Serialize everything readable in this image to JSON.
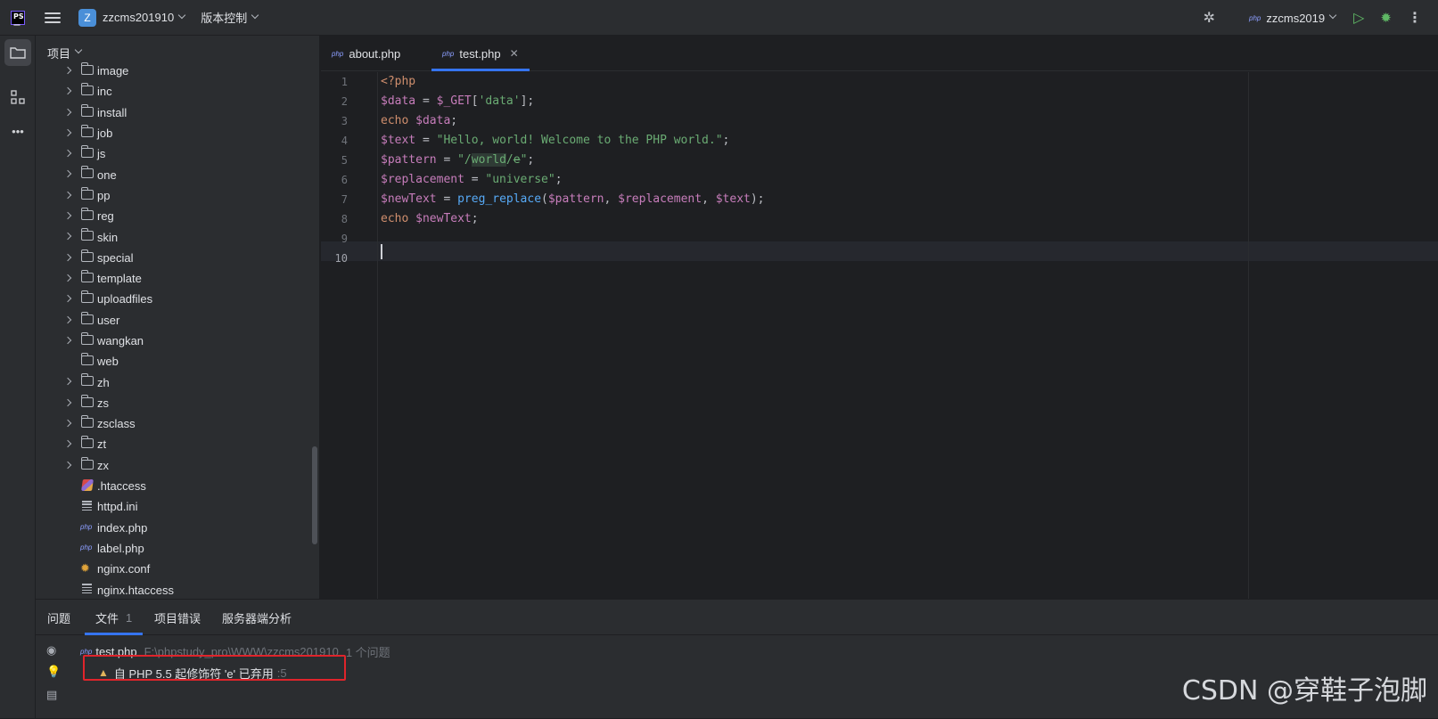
{
  "titlebar": {
    "project_badge": "Z",
    "project_name": "zzcms201910",
    "vcs_label": "版本控制",
    "run_config": "zzcms2019",
    "run_config_icon": "php-icon"
  },
  "project_panel": {
    "header": "项目",
    "items": [
      {
        "name": "image",
        "type": "folder",
        "expandable": true
      },
      {
        "name": "inc",
        "type": "folder",
        "expandable": true
      },
      {
        "name": "install",
        "type": "folder",
        "expandable": true
      },
      {
        "name": "job",
        "type": "folder",
        "expandable": true
      },
      {
        "name": "js",
        "type": "folder",
        "expandable": true
      },
      {
        "name": "one",
        "type": "folder",
        "expandable": true
      },
      {
        "name": "pp",
        "type": "folder",
        "expandable": true
      },
      {
        "name": "reg",
        "type": "folder",
        "expandable": true
      },
      {
        "name": "skin",
        "type": "folder",
        "expandable": true
      },
      {
        "name": "special",
        "type": "folder",
        "expandable": true
      },
      {
        "name": "template",
        "type": "folder",
        "expandable": true
      },
      {
        "name": "uploadfiles",
        "type": "folder",
        "expandable": true
      },
      {
        "name": "user",
        "type": "folder",
        "expandable": true
      },
      {
        "name": "wangkan",
        "type": "folder",
        "expandable": true
      },
      {
        "name": "web",
        "type": "folder",
        "expandable": false
      },
      {
        "name": "zh",
        "type": "folder",
        "expandable": true
      },
      {
        "name": "zs",
        "type": "folder",
        "expandable": true
      },
      {
        "name": "zsclass",
        "type": "folder",
        "expandable": true
      },
      {
        "name": "zt",
        "type": "folder",
        "expandable": true
      },
      {
        "name": "zx",
        "type": "folder",
        "expandable": true
      },
      {
        "name": ".htaccess",
        "type": "htaccess",
        "expandable": false
      },
      {
        "name": "httpd.ini",
        "type": "text",
        "expandable": false
      },
      {
        "name": "index.php",
        "type": "php",
        "expandable": false
      },
      {
        "name": "label.php",
        "type": "php",
        "expandable": false
      },
      {
        "name": "nginx.conf",
        "type": "conf",
        "expandable": false
      },
      {
        "name": "nginx.htaccess",
        "type": "text",
        "expandable": false
      }
    ]
  },
  "editor": {
    "tabs": [
      {
        "label": "about.php",
        "active": false
      },
      {
        "label": "test.php",
        "active": true
      }
    ],
    "current_line": 10,
    "lines": [
      {
        "n": "1"
      },
      {
        "n": "2"
      },
      {
        "n": "3"
      },
      {
        "n": "4"
      },
      {
        "n": "5"
      },
      {
        "n": "6"
      },
      {
        "n": "7"
      },
      {
        "n": "8"
      },
      {
        "n": "9"
      },
      {
        "n": "10"
      }
    ],
    "code": {
      "l1": "<?php",
      "l2_var": "$data",
      "l2_op": " = ",
      "l2_get": "$_GET",
      "l2_br1": "[",
      "l2_key": "'data'",
      "l2_br2": "];",
      "l3_kw": "echo ",
      "l3_var": "$data",
      "l3_end": ";",
      "l4_var": "$text",
      "l4_op": " = ",
      "l4_str": "\"Hello, world! Welcome to the PHP world.\"",
      "l4_end": ";",
      "l5_var": "$pattern",
      "l5_op": " = ",
      "l5_q1": "\"/",
      "l5_world": "world",
      "l5_slash": "/",
      "l5_e": "e",
      "l5_q2": "\"",
      "l5_end": ";",
      "l6_var": "$replacement",
      "l6_op": " = ",
      "l6_str": "\"universe\"",
      "l6_end": ";",
      "l7_var": "$newText",
      "l7_op": " = ",
      "l7_fn": "preg_replace",
      "l7_p1": "(",
      "l7_a1": "$pattern",
      "l7_c1": ", ",
      "l7_a2": "$replacement",
      "l7_c2": ", ",
      "l7_a3": "$text",
      "l7_p2": ");",
      "l8_kw": "echo ",
      "l8_var": "$newText",
      "l8_end": ";"
    }
  },
  "problems": {
    "tabs": [
      {
        "label": "问题",
        "count": ""
      },
      {
        "label": "文件",
        "count": "1"
      },
      {
        "label": "项目错误",
        "count": ""
      },
      {
        "label": "服务器端分析",
        "count": ""
      }
    ],
    "file": "test.php",
    "path": "F:\\phpstudy_pro\\WWW\\zzcms201910",
    "issue_count": "1 个问题",
    "issue_text": "自 PHP 5.5 起修饰符 'e' 已弃用",
    "issue_line": ":5"
  },
  "watermark": "CSDN @穿鞋子泡脚"
}
